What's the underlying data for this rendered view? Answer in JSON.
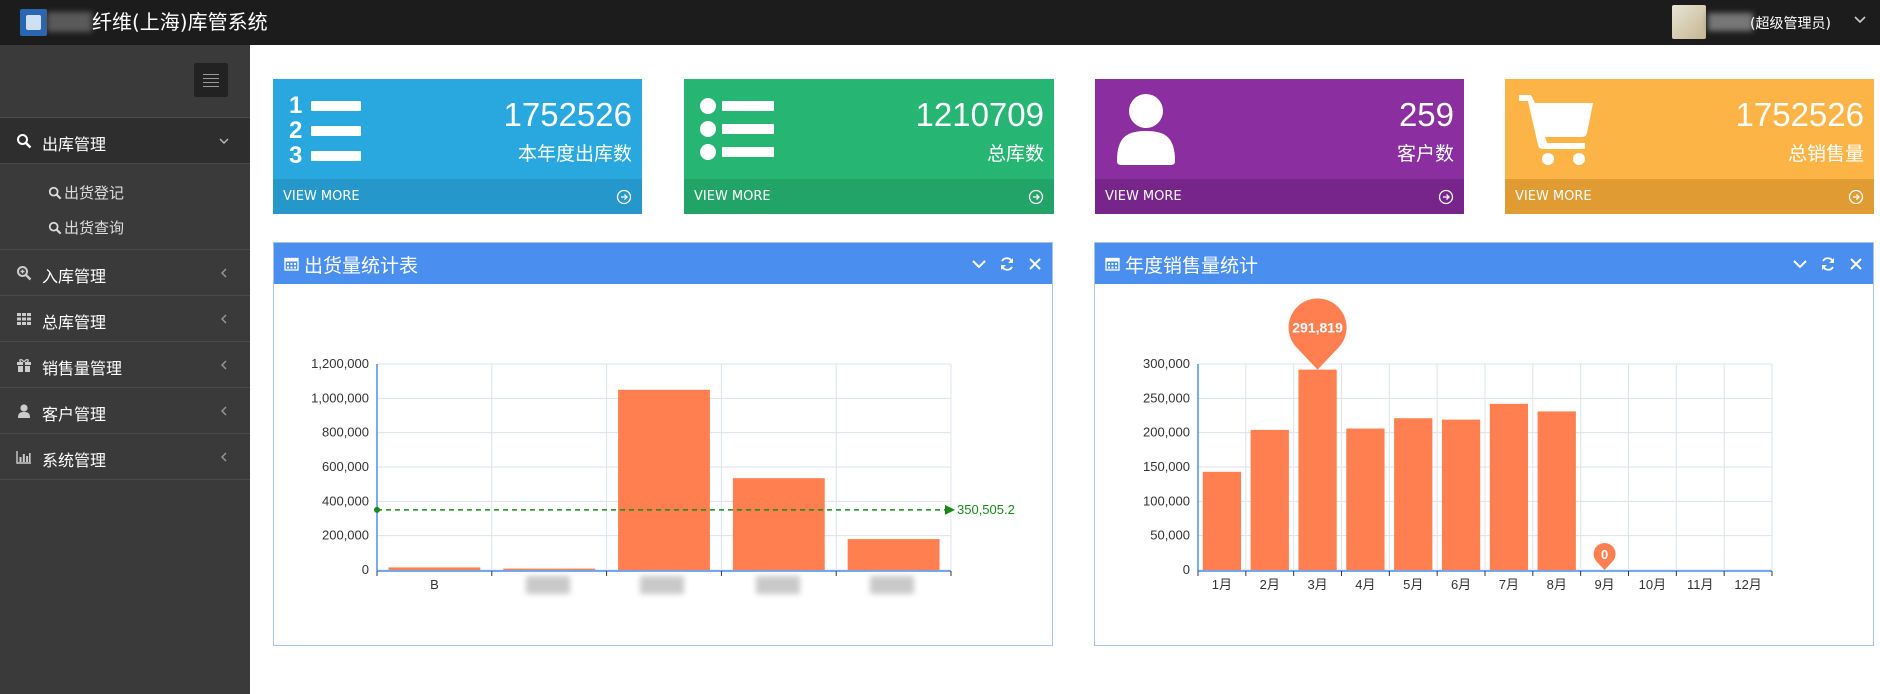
{
  "header": {
    "app_title": "纤维(上海)库管系统",
    "user_role": "(超级管理员)"
  },
  "sidebar": {
    "items": [
      {
        "label": "出库管理",
        "icon": "search-icon",
        "expanded": true,
        "children": [
          {
            "label": "出货登记"
          },
          {
            "label": "出货查询"
          }
        ]
      },
      {
        "label": "入库管理",
        "icon": "zoom-in-icon"
      },
      {
        "label": "总库管理",
        "icon": "grid-icon"
      },
      {
        "label": "销售量管理",
        "icon": "gift-icon"
      },
      {
        "label": "客户管理",
        "icon": "user-icon"
      },
      {
        "label": "系统管理",
        "icon": "bar-chart-icon"
      }
    ]
  },
  "cards": [
    {
      "value": "1752526",
      "label": "本年度出库数",
      "more": "VIEW MORE",
      "color": "#29a8e0",
      "foot_color": "#2597ca",
      "icon": "ordered-list-icon"
    },
    {
      "value": "1210709",
      "label": "总库数",
      "more": "VIEW MORE",
      "color": "#27b574",
      "foot_color": "#22a367",
      "icon": "list-icon"
    },
    {
      "value": "259",
      "label": "客户数",
      "more": "VIEW MORE",
      "color": "#8a2ea0",
      "foot_color": "#77258b",
      "icon": "user-icon"
    },
    {
      "value": "1752526",
      "label": "总销售量",
      "more": "VIEW MORE",
      "color": "#fdb447",
      "foot_color": "#e09b33",
      "icon": "shopping-cart-icon"
    }
  ],
  "panels": {
    "left_title": "出货量统计表",
    "right_title": "年度销售量统计"
  },
  "chart_data": [
    {
      "type": "bar",
      "categories": [
        "B",
        "",
        "",
        "",
        ""
      ],
      "values": [
        15000,
        8000,
        1050000,
        535000,
        180000
      ],
      "ylim": [
        0,
        1200000
      ],
      "yticks": [
        "1,200,000",
        "1,000,000",
        "800,000",
        "600,000",
        "400,000",
        "200,000",
        "0"
      ],
      "mark_line": {
        "value": 350505.2,
        "label": "350,505.2"
      },
      "bar_color": "#ff7f50",
      "grid": true
    },
    {
      "type": "bar",
      "categories": [
        "1月",
        "2月",
        "3月",
        "4月",
        "5月",
        "6月",
        "7月",
        "8月",
        "9月",
        "10月",
        "11月",
        "12月"
      ],
      "values": [
        143000,
        204000,
        291819,
        206000,
        221000,
        219000,
        242000,
        231000,
        0,
        null,
        null,
        null
      ],
      "ylim": [
        0,
        300000
      ],
      "yticks": [
        "300,000",
        "250,000",
        "200,000",
        "150,000",
        "100,000",
        "50,000",
        "0"
      ],
      "mark_points": [
        {
          "index": 2,
          "label": "291,819"
        },
        {
          "index": 8,
          "label": "0"
        }
      ],
      "bar_color": "#ff7f50",
      "grid": true
    }
  ]
}
